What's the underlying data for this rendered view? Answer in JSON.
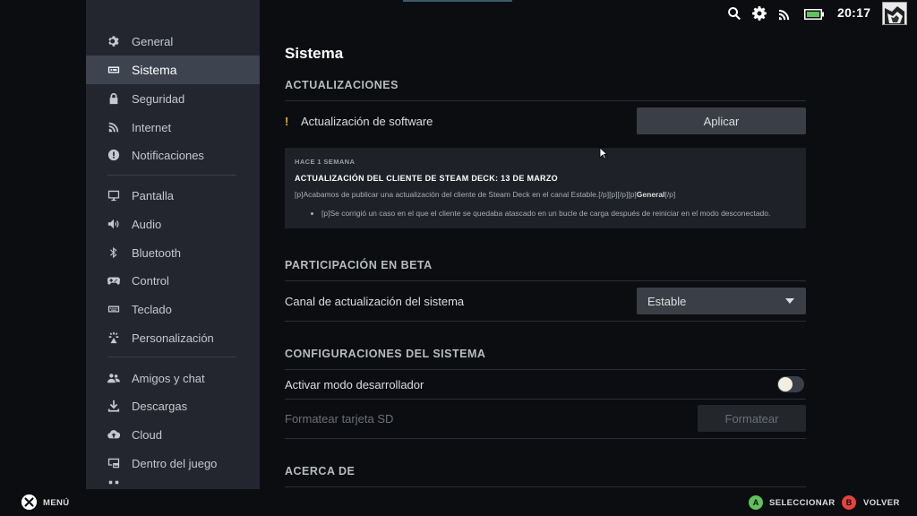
{
  "sidebar": {
    "items": [
      {
        "label": "General",
        "icon": "gear-icon"
      },
      {
        "label": "Sistema",
        "icon": "system-icon",
        "active": true
      },
      {
        "label": "Seguridad",
        "icon": "lock-icon"
      },
      {
        "label": "Internet",
        "icon": "wifi-icon"
      },
      {
        "label": "Notificaciones",
        "icon": "alert-icon"
      },
      {
        "label": "Pantalla",
        "icon": "monitor-icon"
      },
      {
        "label": "Audio",
        "icon": "speaker-icon"
      },
      {
        "label": "Bluetooth",
        "icon": "bluetooth-icon"
      },
      {
        "label": "Control",
        "icon": "gamepad-icon"
      },
      {
        "label": "Teclado",
        "icon": "keyboard-icon"
      },
      {
        "label": "Personalización",
        "icon": "sparkle-icon"
      },
      {
        "label": "Amigos y chat",
        "icon": "friends-icon"
      },
      {
        "label": "Descargas",
        "icon": "download-icon"
      },
      {
        "label": "Cloud",
        "icon": "cloud-icon"
      },
      {
        "label": "Dentro del juego",
        "icon": "ingame-icon"
      }
    ]
  },
  "status": {
    "time": "20:17",
    "icons": [
      "search-icon",
      "gear-icon",
      "wifi-icon",
      "battery-icon"
    ]
  },
  "main": {
    "title": "Sistema",
    "updates": {
      "section": "ACTUALIZACIONES",
      "software_label": "Actualización de software",
      "warn_mark": "!",
      "apply_label": "Aplicar",
      "news": {
        "ago": "HACE 1 SEMANA",
        "headline": "ACTUALIZACIÓN DEL CLIENTE DE STEAM DECK: 13 DE MARZO",
        "body_prefix": "[p]Acabamos de publicar una actualización del cliente de Steam Deck en el canal Estable.[/p][p][/p][p]",
        "body_bold": "General",
        "body_suffix": "[/p]",
        "bullet": "[p]Se corrigió un caso en el que el cliente se quedaba atascado en un bucle de carga después de reiniciar en el modo desconectado."
      }
    },
    "beta": {
      "section": "PARTICIPACIÓN EN BETA",
      "channel_label": "Canal de actualización del sistema",
      "channel_value": "Estable"
    },
    "config": {
      "section": "CONFIGURACIONES DEL SISTEMA",
      "dev_mode_label": "Activar modo desarrollador",
      "dev_mode_on": false,
      "format_label": "Formatear tarjeta SD",
      "format_button": "Formatear"
    },
    "about": {
      "section": "ACERCA DE"
    }
  },
  "footer": {
    "menu_label": "MENÚ",
    "select_key": "A",
    "select_label": "SELECCIONAR",
    "back_key": "B",
    "back_label": "VOLVER",
    "colors": {
      "a": "#5fc25a",
      "b": "#e2433d"
    }
  }
}
